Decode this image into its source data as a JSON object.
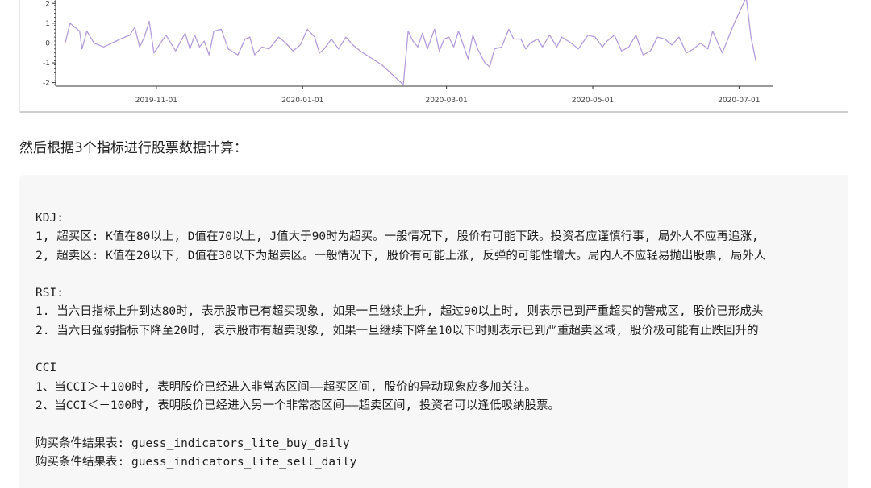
{
  "chart_data": {
    "type": "line",
    "ylim": [
      -2.3,
      2.5
    ],
    "yticks": [
      2,
      1,
      0,
      -1,
      -2
    ],
    "ytick_labels": [
      "2",
      "1",
      "0",
      "-1",
      "-2"
    ],
    "x_range": [
      "2019-09-20",
      "2020-07-15"
    ],
    "xtick_labels": [
      "2019-11-01",
      "2020-01-01",
      "2020-03-01",
      "2020-05-01",
      "2020-07-01"
    ],
    "xtick_dates": [
      "2019-11-01",
      "2020-01-01",
      "2020-03-01",
      "2020-05-01",
      "2020-07-01"
    ],
    "line_color": "#b39ddb",
    "series": [
      {
        "points": [
          [
            "2019-09-24",
            0.0
          ],
          [
            "2019-09-26",
            1.0
          ],
          [
            "2019-09-30",
            0.6
          ],
          [
            "2019-10-01",
            -0.3
          ],
          [
            "2019-10-03",
            0.6
          ],
          [
            "2019-10-06",
            0.0
          ],
          [
            "2019-10-10",
            -0.2
          ],
          [
            "2019-10-17",
            0.2
          ],
          [
            "2019-10-21",
            0.4
          ],
          [
            "2019-10-23",
            0.8
          ],
          [
            "2019-10-25",
            -0.2
          ],
          [
            "2019-10-27",
            0.3
          ],
          [
            "2019-10-29",
            1.1
          ],
          [
            "2019-10-31",
            -0.5
          ],
          [
            "2019-11-05",
            0.4
          ],
          [
            "2019-11-09",
            -0.4
          ],
          [
            "2019-11-13",
            0.5
          ],
          [
            "2019-11-15",
            -0.3
          ],
          [
            "2019-11-17",
            0.4
          ],
          [
            "2019-11-19",
            -0.2
          ],
          [
            "2019-11-21",
            0.1
          ],
          [
            "2019-11-23",
            -0.6
          ],
          [
            "2019-11-25",
            0.6
          ],
          [
            "2019-11-28",
            0.7
          ],
          [
            "2019-12-01",
            -0.3
          ],
          [
            "2019-12-05",
            -0.6
          ],
          [
            "2019-12-08",
            0.2
          ],
          [
            "2019-12-10",
            0.3
          ],
          [
            "2019-12-12",
            -0.6
          ],
          [
            "2019-12-15",
            -0.2
          ],
          [
            "2019-12-18",
            -0.3
          ],
          [
            "2019-12-22",
            0.3
          ],
          [
            "2019-12-25",
            0.0
          ],
          [
            "2019-12-28",
            -0.4
          ],
          [
            "2019-12-31",
            -0.1
          ],
          [
            "2020-01-03",
            0.7
          ],
          [
            "2020-01-06",
            0.3
          ],
          [
            "2020-01-08",
            -0.5
          ],
          [
            "2020-01-10",
            -0.3
          ],
          [
            "2020-01-13",
            0.2
          ],
          [
            "2020-01-16",
            -0.3
          ],
          [
            "2020-01-19",
            0.3
          ],
          [
            "2020-01-22",
            -0.1
          ],
          [
            "2020-01-25",
            -0.4
          ],
          [
            "2020-02-03",
            -1.1
          ],
          [
            "2020-02-12",
            -2.1
          ],
          [
            "2020-02-14",
            0.6
          ],
          [
            "2020-02-16",
            0.1
          ],
          [
            "2020-02-18",
            -0.2
          ],
          [
            "2020-02-20",
            0.5
          ],
          [
            "2020-02-22",
            -0.3
          ],
          [
            "2020-02-25",
            0.7
          ],
          [
            "2020-02-27",
            -0.4
          ],
          [
            "2020-02-29",
            0.2
          ],
          [
            "2020-03-02",
            0.3
          ],
          [
            "2020-03-04",
            -0.2
          ],
          [
            "2020-03-06",
            0.6
          ],
          [
            "2020-03-08",
            -0.1
          ],
          [
            "2020-03-10",
            -0.8
          ],
          [
            "2020-03-12",
            0.4
          ],
          [
            "2020-03-14",
            -0.3
          ],
          [
            "2020-03-17",
            -1.0
          ],
          [
            "2020-03-19",
            -1.2
          ],
          [
            "2020-03-21",
            -0.3
          ],
          [
            "2020-03-24",
            -0.2
          ],
          [
            "2020-03-27",
            0.7
          ],
          [
            "2020-03-29",
            0.2
          ],
          [
            "2020-04-01",
            0.2
          ],
          [
            "2020-04-03",
            -0.3
          ],
          [
            "2020-04-05",
            0.0
          ],
          [
            "2020-04-08",
            0.2
          ],
          [
            "2020-04-10",
            -0.2
          ],
          [
            "2020-04-13",
            0.4
          ],
          [
            "2020-04-16",
            -0.2
          ],
          [
            "2020-04-18",
            0.3
          ],
          [
            "2020-04-22",
            0.0
          ],
          [
            "2020-04-25",
            -0.3
          ],
          [
            "2020-04-29",
            0.4
          ],
          [
            "2020-05-02",
            0.3
          ],
          [
            "2020-05-05",
            -0.2
          ],
          [
            "2020-05-07",
            0.1
          ],
          [
            "2020-05-10",
            0.4
          ],
          [
            "2020-05-13",
            -0.4
          ],
          [
            "2020-05-16",
            -0.2
          ],
          [
            "2020-05-19",
            0.4
          ],
          [
            "2020-05-22",
            -0.6
          ],
          [
            "2020-05-25",
            -0.4
          ],
          [
            "2020-05-28",
            0.3
          ],
          [
            "2020-05-31",
            0.2
          ],
          [
            "2020-06-03",
            -0.1
          ],
          [
            "2020-06-06",
            0.3
          ],
          [
            "2020-06-09",
            -0.5
          ],
          [
            "2020-06-12",
            -0.3
          ],
          [
            "2020-06-15",
            0.0
          ],
          [
            "2020-06-18",
            -0.3
          ],
          [
            "2020-06-20",
            0.6
          ],
          [
            "2020-06-24",
            -0.5
          ],
          [
            "2020-06-29",
            1.0
          ],
          [
            "2020-07-04",
            2.3
          ],
          [
            "2020-07-06",
            0.3
          ],
          [
            "2020-07-08",
            -0.9
          ]
        ]
      }
    ]
  },
  "intro_text": "然后根据3个指标进行股票数据计算：",
  "code_lines": [
    "KDJ:",
    "1, 超买区: K值在80以上, D值在70以上, J值大于90时为超买。一般情况下, 股价有可能下跌。投资者应谨慎行事, 局外人不应再追涨,",
    "2, 超卖区: K值在20以下, D值在30以下为超卖区。一般情况下, 股价有可能上涨, 反弹的可能性增大。局内人不应轻易抛出股票, 局外人",
    "",
    "RSI:",
    "1. 当六日指标上升到达80时, 表示股市已有超买现象, 如果一旦继续上升, 超过90以上时, 则表示已到严重超买的警戒区, 股价已形成头",
    "2. 当六日强弱指标下降至20时, 表示股市有超卖现象, 如果一旦继续下降至10以下时则表示已到严重超卖区域, 股价极可能有止跌回升的",
    "",
    "CCI",
    "1、当CCI＞＋100时, 表明股价已经进入非常态区间——超买区间, 股价的异动现象应多加关注。",
    "2、当CCI＜－100时, 表明股价已经进入另一个非常态区间——超卖区间, 投资者可以逢低吸纳股票。",
    "",
    "购买条件结果表: guess_indicators_lite_buy_daily",
    "购买条件结果表: guess_indicators_lite_sell_daily"
  ]
}
